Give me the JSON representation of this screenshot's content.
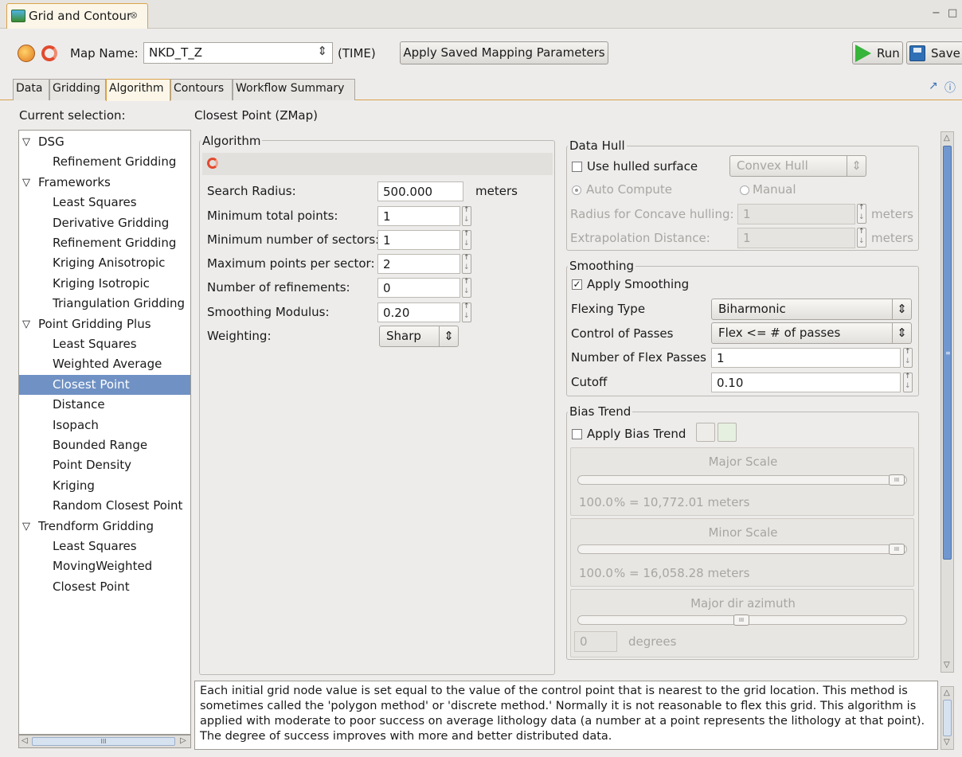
{
  "view": {
    "title": "Grid and Contour",
    "close_glyph": "⊗",
    "min_glyph": "−",
    "max_glyph": "□"
  },
  "toolbar": {
    "map_name_label": "Map Name:",
    "map_name_value": "NKD_T_Z",
    "domain_label": "(TIME)",
    "apply_saved_label": "Apply Saved Mapping Parameters",
    "run_label": "Run",
    "save_label": "Save"
  },
  "tabs": [
    {
      "label": "Data"
    },
    {
      "label": "Gridding"
    },
    {
      "label": "Algorithm"
    },
    {
      "label": "Contours"
    },
    {
      "label": "Workflow Summary"
    }
  ],
  "tree": {
    "header": "Current selection:",
    "items": [
      {
        "label": "DSG",
        "level": 0
      },
      {
        "label": "Refinement Gridding",
        "level": 1
      },
      {
        "label": "Frameworks",
        "level": 0
      },
      {
        "label": "Least Squares",
        "level": 1
      },
      {
        "label": "Derivative Gridding",
        "level": 1
      },
      {
        "label": "Refinement Gridding",
        "level": 1
      },
      {
        "label": "Kriging Anisotropic",
        "level": 1
      },
      {
        "label": "Kriging Isotropic",
        "level": 1
      },
      {
        "label": "Triangulation Gridding",
        "level": 1
      },
      {
        "label": "Point Gridding Plus",
        "level": 0
      },
      {
        "label": "Least Squares",
        "level": 1
      },
      {
        "label": "Weighted Average",
        "level": 1
      },
      {
        "label": "Closest Point",
        "level": 1,
        "selected": true
      },
      {
        "label": "Distance",
        "level": 1
      },
      {
        "label": "Isopach",
        "level": 1
      },
      {
        "label": "Bounded Range",
        "level": 1
      },
      {
        "label": "Point Density",
        "level": 1
      },
      {
        "label": "Kriging",
        "level": 1
      },
      {
        "label": "Random Closest Point",
        "level": 1
      },
      {
        "label": "Trendform Gridding",
        "level": 0
      },
      {
        "label": "Least Squares",
        "level": 1
      },
      {
        "label": "MovingWeighted",
        "level": 1
      },
      {
        "label": "Closest Point",
        "level": 1
      }
    ]
  },
  "algorithm": {
    "title": "Closest Point (ZMap)",
    "group_label": "Algorithm",
    "search_radius": {
      "label": "Search Radius:",
      "value": "500.000",
      "unit": "meters"
    },
    "min_total_points": {
      "label": "Minimum total points:",
      "value": "1"
    },
    "min_sectors": {
      "label": "Minimum number of sectors:",
      "value": "1"
    },
    "max_per_sector": {
      "label": "Maximum points per sector:",
      "value": "2"
    },
    "refinements": {
      "label": "Number of refinements:",
      "value": "0"
    },
    "smoothing_modulus": {
      "label": "Smoothing Modulus:",
      "value": "0.20"
    },
    "weighting": {
      "label": "Weighting:",
      "value": "Sharp"
    }
  },
  "data_hull": {
    "group_label": "Data Hull",
    "use_hulled_label": "Use hulled surface",
    "use_hulled_checked": false,
    "hull_type": "Convex Hull",
    "auto_compute_label": "Auto Compute",
    "manual_label": "Manual",
    "radius_label": "Radius for Concave hulling:",
    "radius_value": "1",
    "radius_unit": "meters",
    "extrap_label": "Extrapolation Distance:",
    "extrap_value": "1",
    "extrap_unit": "meters"
  },
  "smoothing": {
    "group_label": "Smoothing",
    "apply_label": "Apply Smoothing",
    "apply_checked": true,
    "flexing_type_label": "Flexing Type",
    "flexing_type_value": "Biharmonic",
    "control_label": "Control of Passes",
    "control_value": "Flex <= # of passes",
    "flex_passes_label": "Number of Flex Passes",
    "flex_passes_value": "1",
    "cutoff_label": "Cutoff",
    "cutoff_value": "0.10"
  },
  "bias_trend": {
    "group_label": "Bias Trend",
    "apply_label": "Apply Bias Trend",
    "apply_checked": false,
    "major_scale_title": "Major Scale",
    "major_scale_value": "100.0",
    "major_scale_text": "% = 10,772.01 meters",
    "major_scale_fraction": 1.0,
    "minor_scale_title": "Minor Scale",
    "minor_scale_value": "100.0",
    "minor_scale_text": "% = 16,058.28 meters",
    "minor_scale_fraction": 1.0,
    "azimuth_title": "Major dir azimuth",
    "azimuth_value": "0",
    "azimuth_unit": "degrees",
    "azimuth_fraction": 0.5
  },
  "description": "Each initial grid node value is set equal to the value of the control point that is nearest to the grid location.  This method is sometimes called the 'polygon method' or 'discrete method.'  Normally it is not reasonable to flex this grid.  This algorithm is applied with moderate to poor success on average lithology data (a number at a point represents the lithology at that point).  The degree of success improves with more and better distributed data.",
  "icons": {
    "chk_mark": "✓",
    "tree_expanded": "▽",
    "combo_arrow": "⇕",
    "scroll_left": "◁",
    "scroll_right": "▷",
    "scroll_up": "△",
    "scroll_down": "▽"
  }
}
